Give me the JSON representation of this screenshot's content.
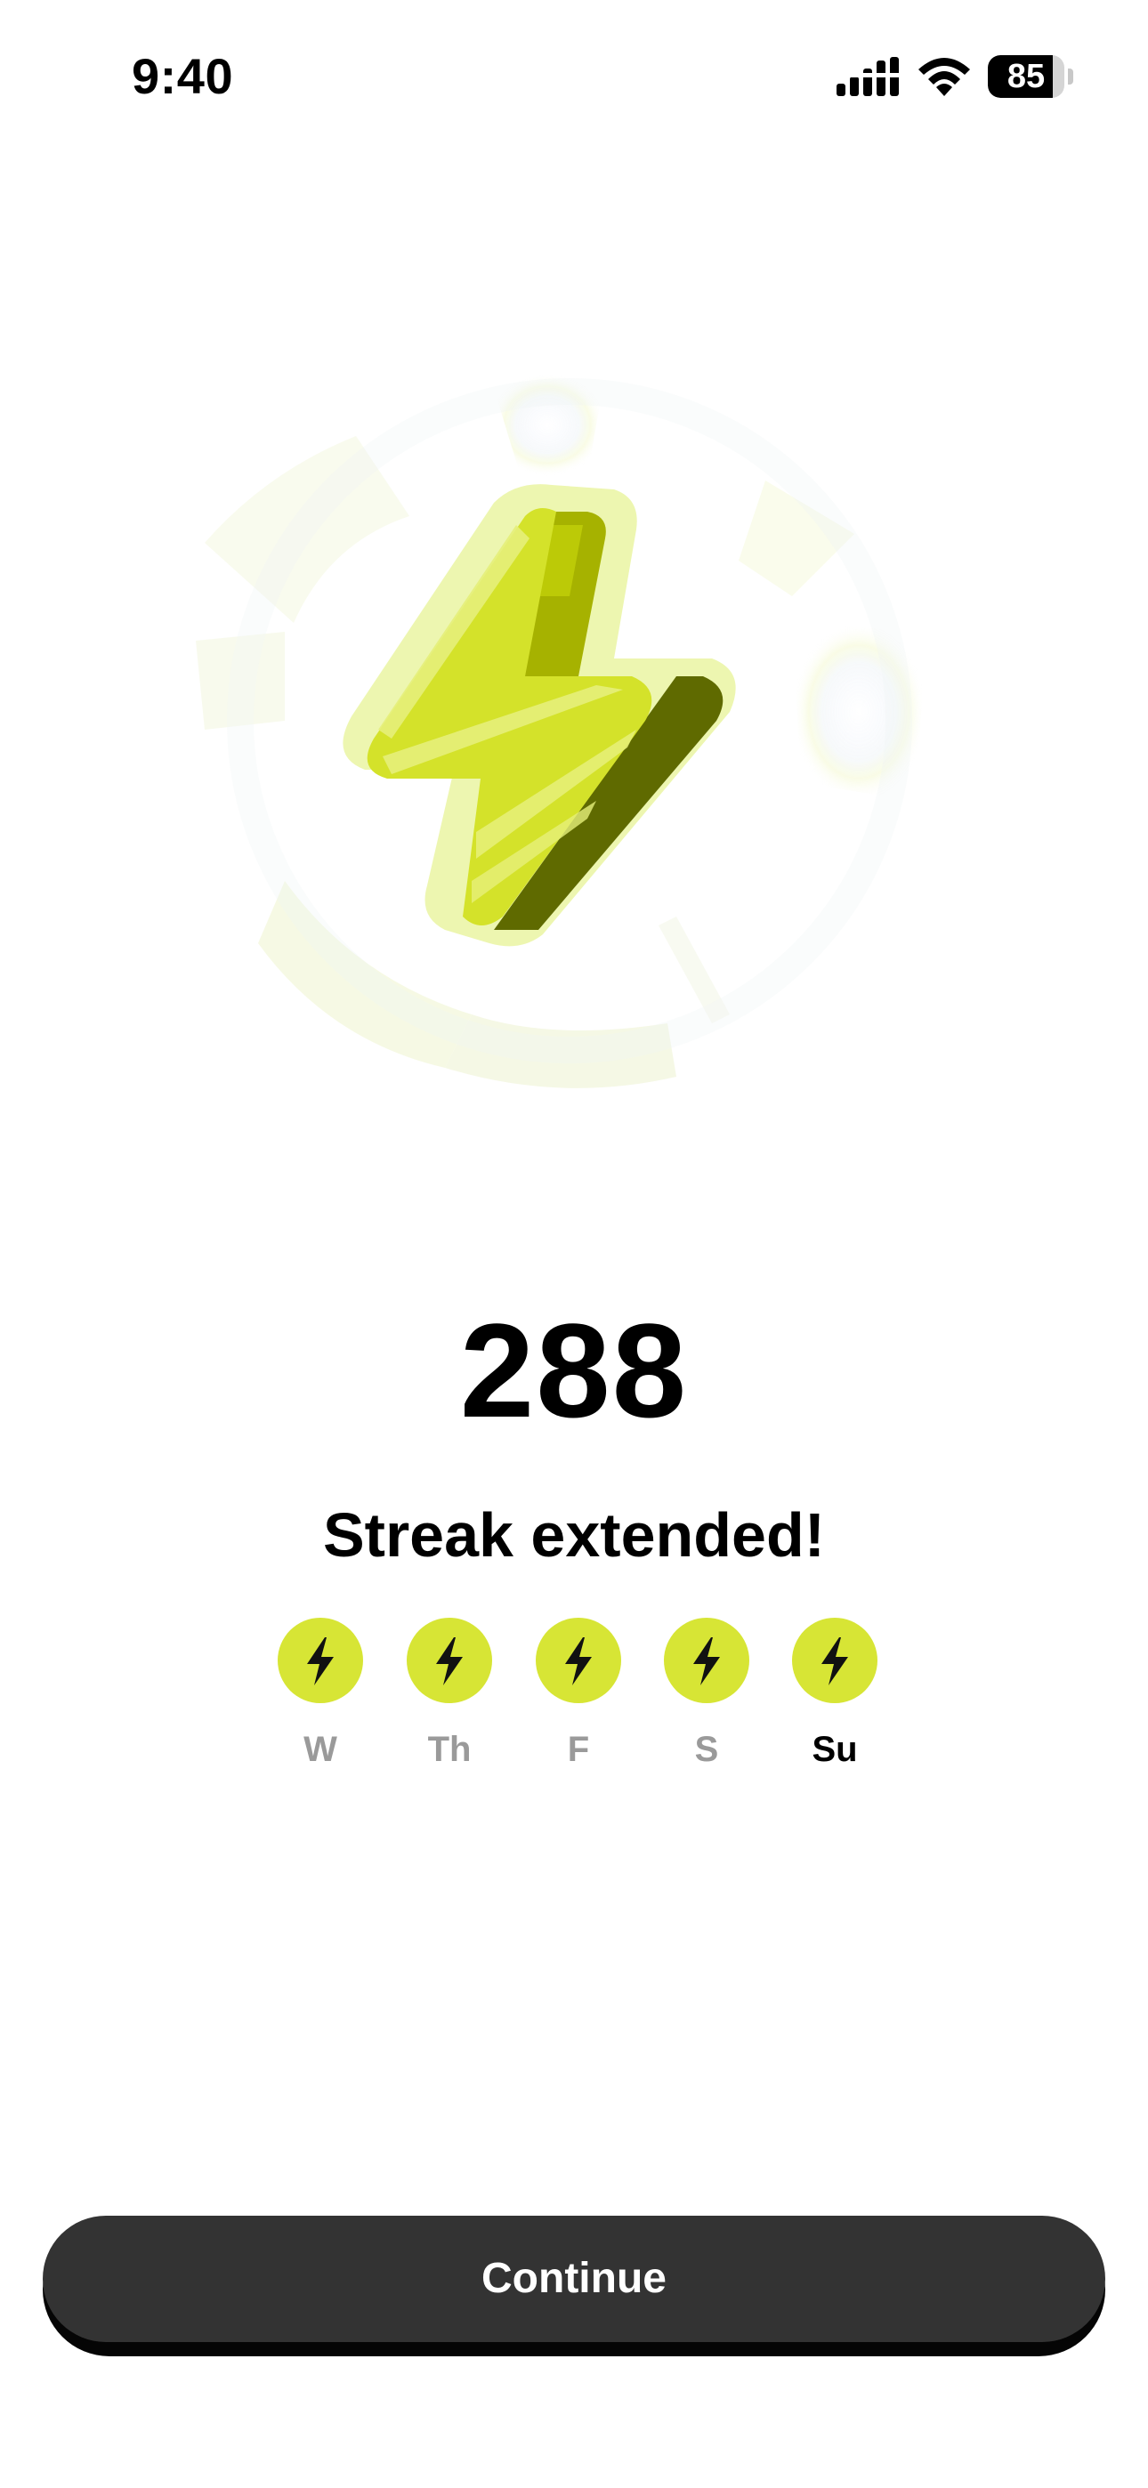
{
  "status_bar": {
    "time": "9:40",
    "battery_level": "85",
    "battery_fraction": 0.85,
    "icons": [
      "cellular-signal-icon",
      "wifi-icon",
      "battery-icon"
    ]
  },
  "hero": {
    "icon": "lightning-bolt-icon"
  },
  "streak": {
    "count": "288",
    "title": "Streak extended!"
  },
  "week": {
    "days": [
      {
        "label": "W",
        "completed": true,
        "current": false
      },
      {
        "label": "Th",
        "completed": true,
        "current": false
      },
      {
        "label": "F",
        "completed": true,
        "current": false
      },
      {
        "label": "S",
        "completed": true,
        "current": false
      },
      {
        "label": "Su",
        "completed": true,
        "current": true
      }
    ]
  },
  "actions": {
    "continue_label": "Continue"
  },
  "colors": {
    "accent": "#d7e535",
    "button": "#333333",
    "inactive_day_label": "#9a9a9a",
    "background": "#ffffff"
  }
}
